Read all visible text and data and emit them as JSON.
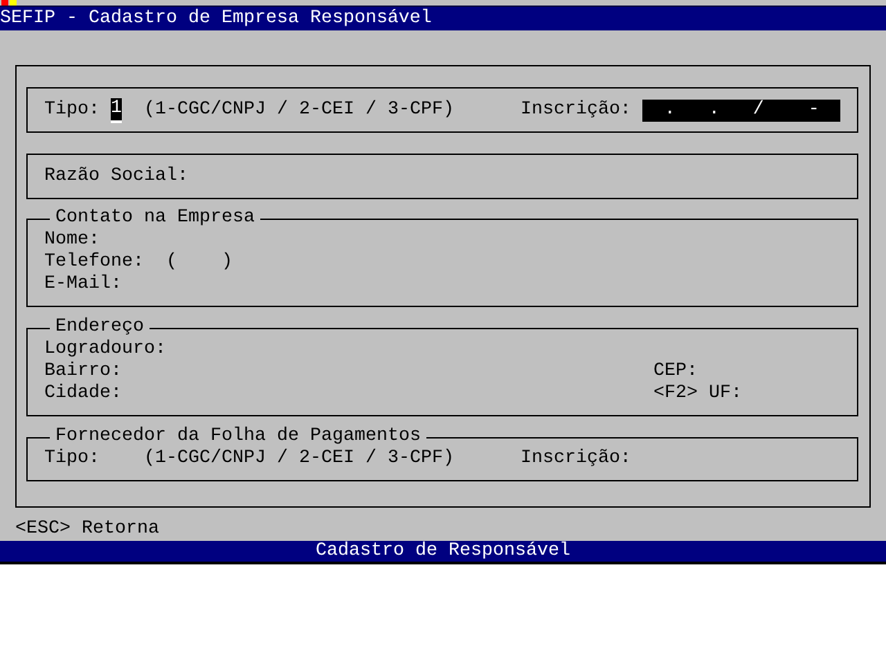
{
  "window": {
    "title": "SEFIP - Cadastro de Empresa Responsável"
  },
  "empresa": {
    "tipo_label": "Tipo:",
    "tipo_value": "1",
    "tipo_focused": true,
    "tipo_hint": "(1-CGC/CNPJ / 2-CEI / 3-CPF)",
    "inscricao_label": "Inscrição:",
    "inscricao_mask": "  .   .   /    -"
  },
  "razao_social": {
    "label": "Razão Social:"
  },
  "contato": {
    "title": "Contato na Empresa",
    "nome_label": "Nome:",
    "telefone_label": "Telefone:",
    "telefone_mask": "(    )",
    "email_label": "E-Mail:"
  },
  "endereco": {
    "title": "Endereço",
    "logradouro_label": "Logradouro:",
    "bairro_label": "Bairro:",
    "cep_label": "CEP:",
    "cidade_label": "Cidade:",
    "uf_label": "<F2> UF:"
  },
  "fornecedor": {
    "title": "Fornecedor da Folha de Pagamentos",
    "tipo_label": "Tipo:",
    "tipo_hint": "(1-CGC/CNPJ / 2-CEI / 3-CPF)",
    "inscricao_label": "Inscrição:"
  },
  "hint_line": "<ESC> Retorna",
  "status_bar": "Cadastro de Responsável"
}
